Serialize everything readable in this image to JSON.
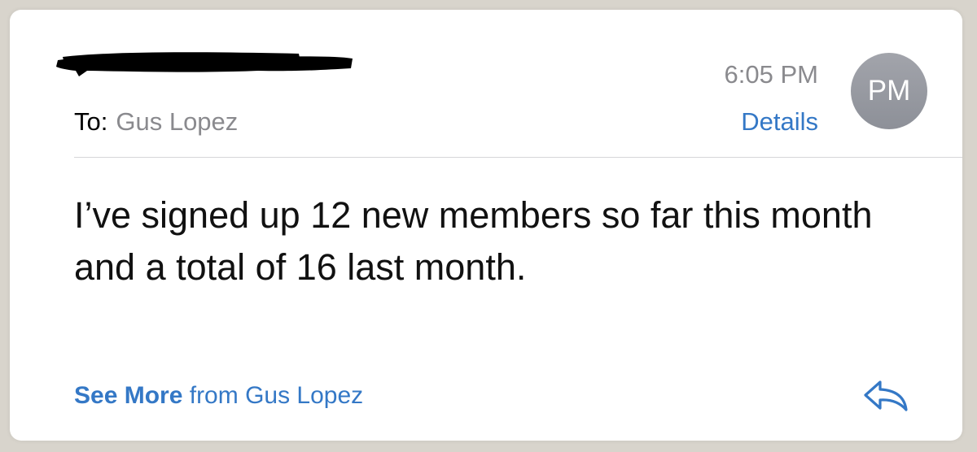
{
  "message": {
    "to_label": "To:",
    "to_name": "Gus Lopez",
    "time": "6:05 PM",
    "details_label": "Details",
    "avatar_initials": "PM",
    "body": "I’ve signed up 12 new members so far this month and a total of 16 last month.",
    "footer_link": "See More",
    "footer_suffix": "from Gus Lopez"
  },
  "colors": {
    "link_blue": "#3478c6",
    "secondary_gray": "#8a8a8e",
    "avatar_gray": "#999ba2"
  },
  "icons": {
    "reply": "reply-arrow-icon"
  }
}
